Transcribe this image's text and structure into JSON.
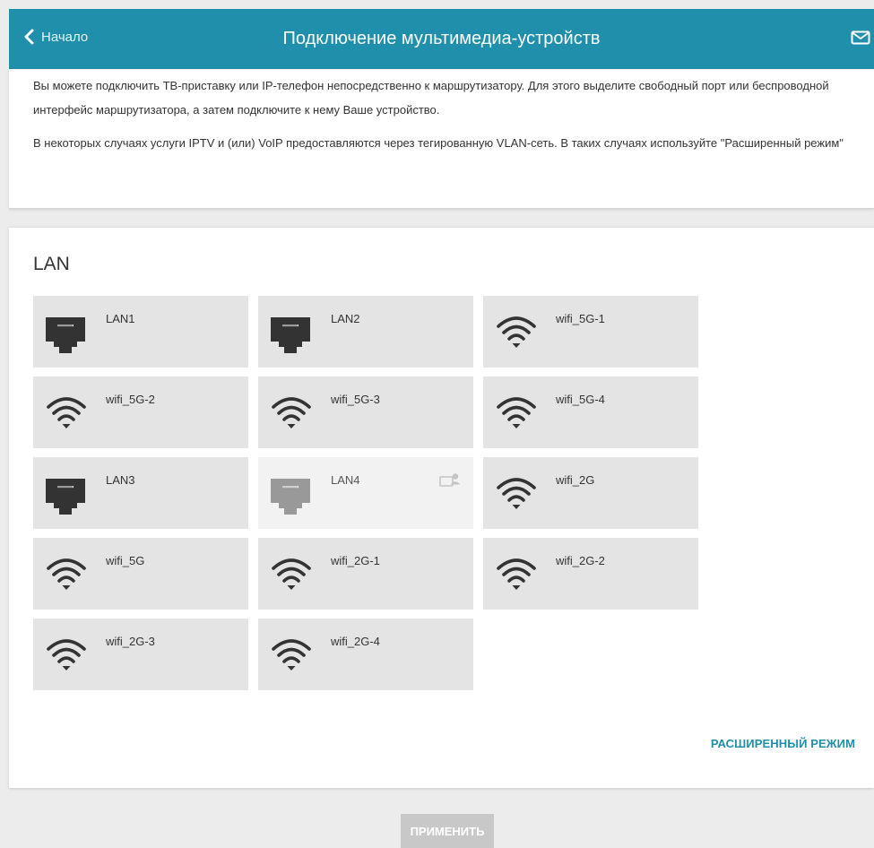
{
  "header": {
    "back_label": "Начало",
    "title": "Подключение мультимедиа-устройств",
    "mail_icon": "mail-icon"
  },
  "info": {
    "paragraph1": "Вы можете подключить ТВ-приставку или IP-телефон непосредственно к маршрутизатору. Для этого выделите свободный порт или беспроводной интерфейс маршрутизатора, а затем подключите к нему Ваше устройство.",
    "paragraph2": "В некоторых случаях услуги IPTV и (или) VoIP предоставляются через тегированную VLAN-сеть. В таких случаях используйте \"Расширенный режим\""
  },
  "lan": {
    "title": "LAN",
    "ports": [
      {
        "label": "LAN1",
        "type": "ethernet",
        "state": "available"
      },
      {
        "label": "LAN2",
        "type": "ethernet",
        "state": "available"
      },
      {
        "label": "wifi_5G-1",
        "type": "wifi",
        "state": "available"
      },
      {
        "label": "wifi_5G-2",
        "type": "wifi",
        "state": "available"
      },
      {
        "label": "wifi_5G-3",
        "type": "wifi",
        "state": "available"
      },
      {
        "label": "wifi_5G-4",
        "type": "wifi",
        "state": "available"
      },
      {
        "label": "LAN3",
        "type": "ethernet",
        "state": "available"
      },
      {
        "label": "LAN4",
        "type": "ethernet",
        "state": "in-use"
      },
      {
        "label": "wifi_2G",
        "type": "wifi",
        "state": "available"
      },
      {
        "label": "wifi_5G",
        "type": "wifi",
        "state": "available"
      },
      {
        "label": "wifi_2G-1",
        "type": "wifi",
        "state": "available"
      },
      {
        "label": "wifi_2G-2",
        "type": "wifi",
        "state": "available"
      },
      {
        "label": "wifi_2G-3",
        "type": "wifi",
        "state": "available"
      },
      {
        "label": "wifi_2G-4",
        "type": "wifi",
        "state": "available"
      }
    ],
    "advanced_label": "РАСШИРЕННЫЙ РЕЖИМ"
  },
  "apply_label": "ПРИМЕНИТЬ",
  "colors": {
    "accent": "#1f8fab",
    "tile": "#e4e4e4",
    "tile_disabled": "#f2f2f2",
    "icon": "#333333",
    "icon_disabled": "#999999",
    "apply_disabled": "#c8c8c8"
  }
}
